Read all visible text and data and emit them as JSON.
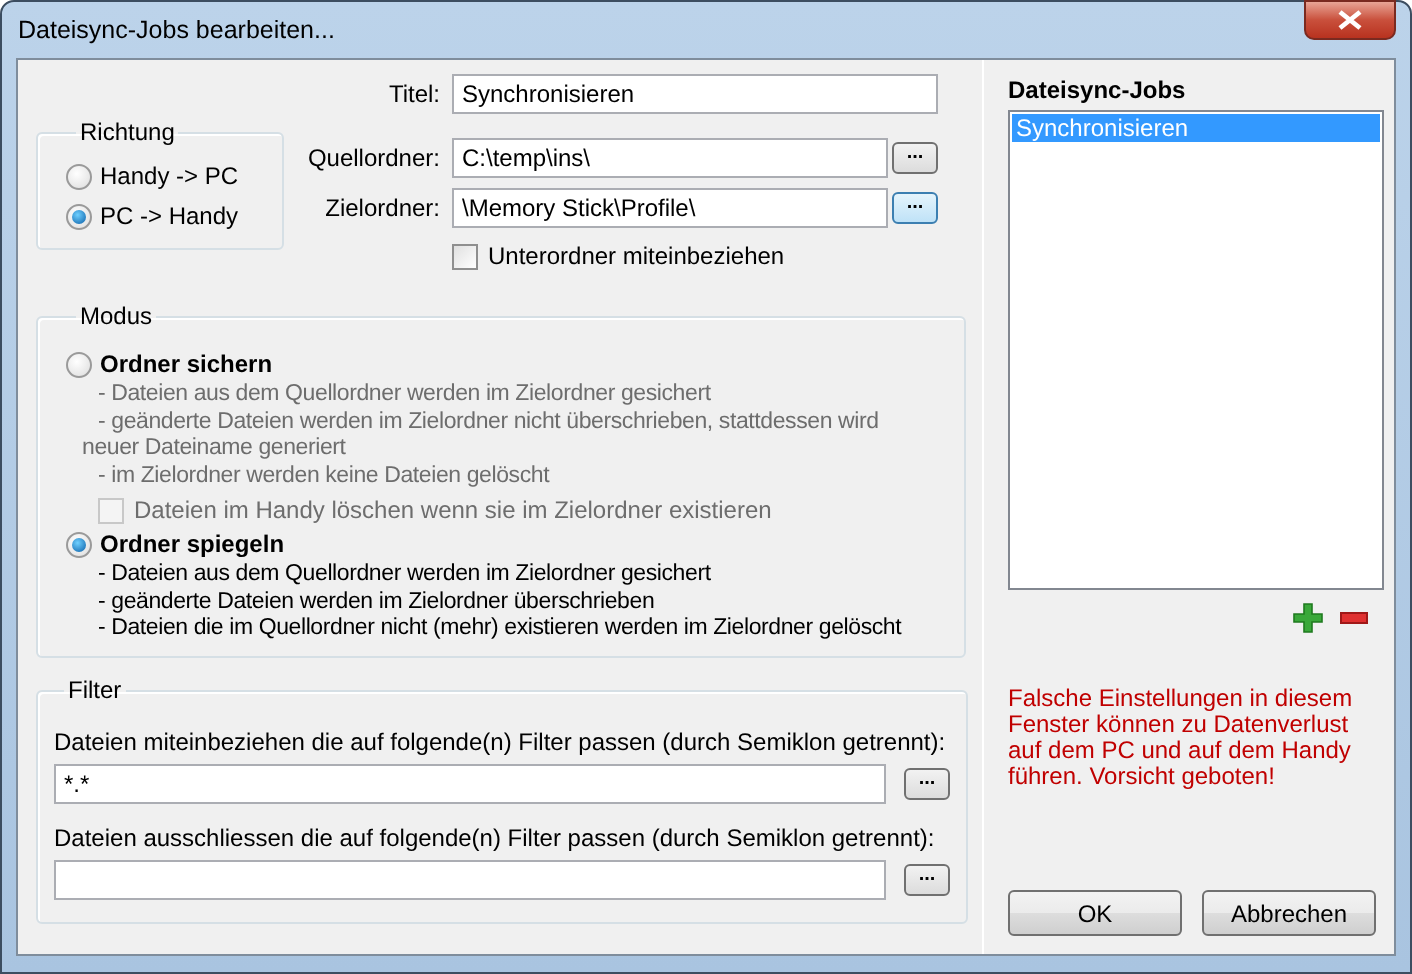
{
  "window": {
    "title": "Dateisync-Jobs bearbeiten..."
  },
  "form": {
    "title_label": "Titel:",
    "title_value": "Synchronisieren",
    "direction": {
      "legend": "Richtung",
      "options": [
        {
          "label": "Handy -> PC",
          "selected": false
        },
        {
          "label": "PC -> Handy",
          "selected": true
        }
      ]
    },
    "folders": [
      {
        "label": "Quellordner:",
        "value": "C:\\temp\\ins\\",
        "button": "...",
        "focused": false
      },
      {
        "label": "Zielordner:",
        "value": "\\Memory Stick\\Profile\\",
        "button": "...",
        "focused": true
      }
    ],
    "include_subfolders": {
      "label": "Unterordner miteinbeziehen",
      "checked": false
    }
  },
  "mode": {
    "legend": "Modus",
    "options": [
      {
        "label": "Ordner sichern",
        "selected": false,
        "disabled": true,
        "description": [
          "- Dateien aus dem Quellordner werden im Zielordner gesichert",
          "- geänderte Dateien werden im Zielordner nicht überschrieben, stattdessen wird",
          "neuer Dateiname generiert",
          "- im Zielordner werden keine Dateien gelöscht"
        ],
        "checkbox": {
          "label": "Dateien im Handy löschen wenn sie im Zielordner existieren",
          "checked": false,
          "disabled": true
        }
      },
      {
        "label": "Ordner spiegeln",
        "selected": true,
        "disabled": false,
        "description": [
          "- Dateien aus dem Quellordner werden im Zielordner gesichert",
          "- geänderte Dateien werden im Zielordner überschrieben",
          "- Dateien die im Quellordner nicht (mehr) existieren werden im Zielordner gelöscht"
        ]
      }
    ]
  },
  "filter": {
    "legend": "Filter",
    "rows": [
      {
        "label": "Dateien miteinbeziehen die auf folgende(n) Filter passen (durch Semiklon getrennt):",
        "value": "*.*",
        "button": "..."
      },
      {
        "label": "Dateien ausschliessen die auf folgende(n) Filter passen (durch Semiklon getrennt):",
        "button": "..."
      }
    ]
  },
  "jobs": {
    "label": "Dateisync-Jobs",
    "items": [
      {
        "label": "Synchronisieren",
        "selected": true
      }
    ]
  },
  "warning": "Falsche Einstellungen in diesem Fenster können zu Datenverlust auf dem PC und auf dem Handy führen. Vorsicht geboten!",
  "buttons": [
    "OK",
    "Abbrechen"
  ]
}
